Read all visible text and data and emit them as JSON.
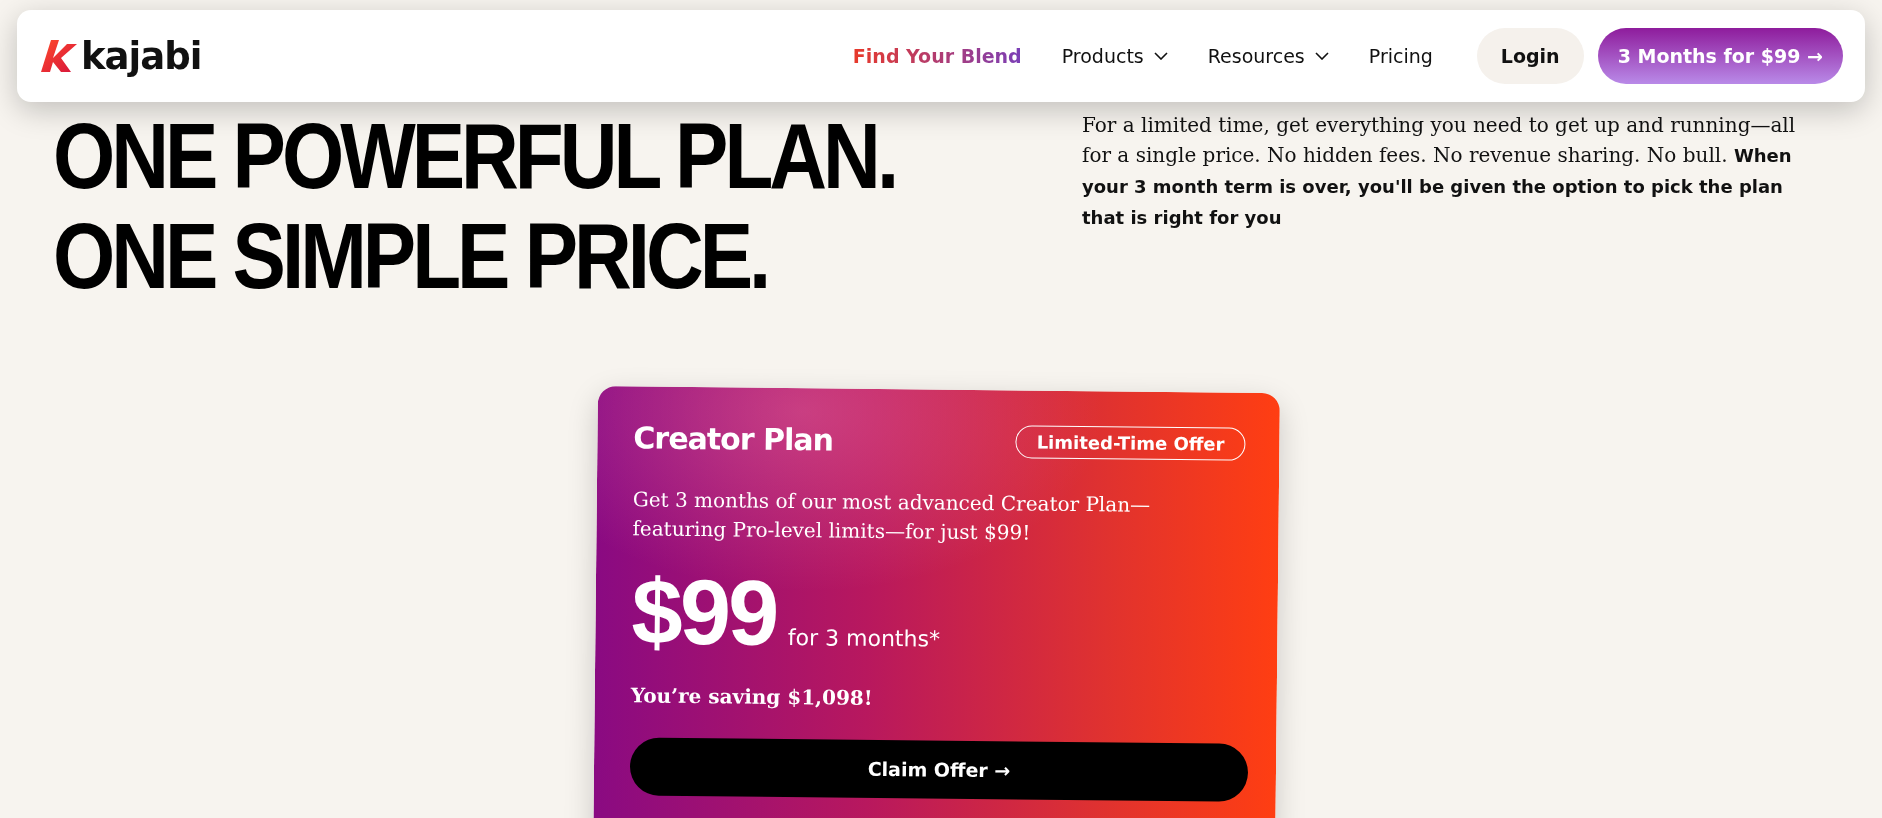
{
  "nav": {
    "logo_text": "kajabi",
    "links": [
      {
        "label": "Find Your Blend",
        "kind": "highlight"
      },
      {
        "label": "Products",
        "kind": "dropdown"
      },
      {
        "label": "Resources",
        "kind": "dropdown"
      },
      {
        "label": "Pricing",
        "kind": "plain"
      }
    ],
    "login": "Login",
    "cta": "3 Months for $99 →"
  },
  "hero": {
    "headline": [
      "ONE POWERFUL PLAN.",
      "ONE SIMPLE PRICE."
    ],
    "intro": "For a limited time, get everything you need to get up and running—all for a single price. No hidden fees. No revenue sharing. No bull. **When your 3 month term is over, you'll be given the option to pick the plan that is right for you**"
  },
  "card": {
    "title": "Creator Plan",
    "badge": "Limited-Time Offer",
    "description": "Get 3 months of our most advanced Creator Plan—featuring Pro-level limits—for just $99!",
    "price": "$99",
    "term": "for 3 months*",
    "saving": "You’re saving $1,098!",
    "button": "Claim Offer →"
  }
}
